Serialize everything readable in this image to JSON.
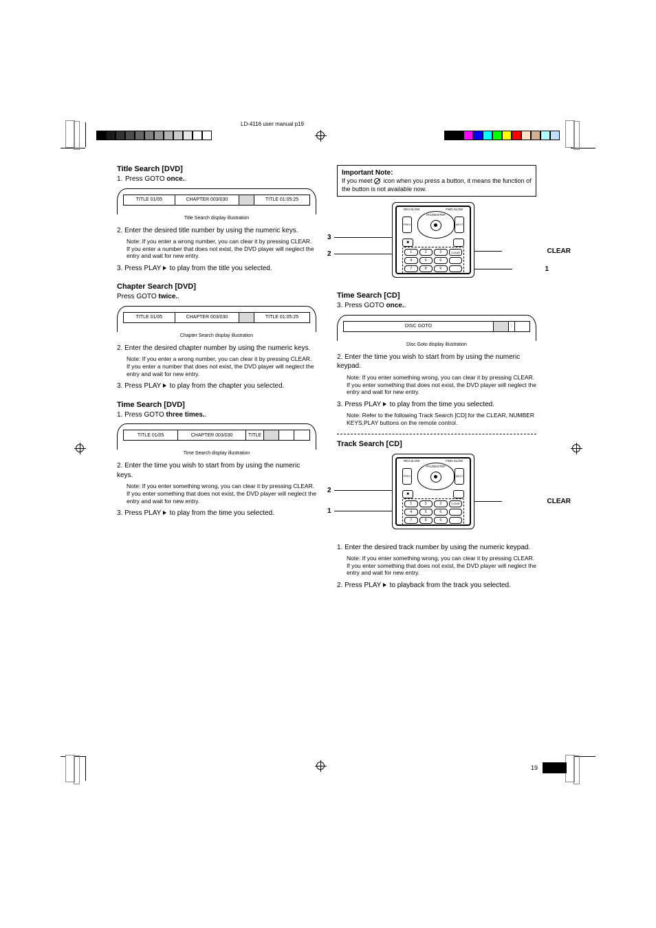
{
  "meta": {
    "filename": "LD-4116 user manual p19",
    "page_number": "19"
  },
  "marks": {
    "gray_swatches": [
      "#000000",
      "#1a1a1a",
      "#333333",
      "#4d4d4d",
      "#666666",
      "#808080",
      "#999999",
      "#b3b3b3",
      "#cccccc",
      "#e6e6e6",
      "#ffffff",
      "#ffffff"
    ],
    "color_swatches": [
      "#ff00ff",
      "#0000ff",
      "#00ffff",
      "#00ff00",
      "#ffff00",
      "#ff0000",
      "#ffe0c0",
      "#d0b090",
      "#b0ffff",
      "#c0e0ff",
      "#000000",
      "#000000"
    ]
  },
  "important_note": {
    "title": "Important Note:",
    "body_1": "If you meet ",
    "body_2": " icon when you press a button, it means the function of the button is not available now."
  },
  "remote_labels": {
    "clear": "CLEAR",
    "num1": "1",
    "num2": "2",
    "num3": "3",
    "pause": "PAUSE/STEP",
    "prev": "PREV",
    "next": "NEXT",
    "rev": "REV.SLOW",
    "fwd": "FWD.SLOW",
    "stop": "■",
    "btn_clear": "CLEAR"
  },
  "left": {
    "title_search": {
      "heading": "Title Search [DVD]",
      "step1a": "1. Press GOTO ",
      "step1b": "once.",
      "display_caption": "Title Search display illustration",
      "seg1": "TITLE   01/05",
      "seg2": "CHAPTER   003/030",
      "seg3": "",
      "seg4": "TITLE   01:05:25",
      "step2": "2. Enter the desired title number by using the numeric keys.",
      "note1": "Note: If you enter a wrong number, you can clear it by pressing CLEAR. If you enter a number that does not exist, the DVD player will neglect the entry and wait for new entry.",
      "step3_pre": "3. Press PLAY ",
      "step3_post": " to play from the title you selected."
    },
    "chapter_search": {
      "heading": "Chapter Search [DVD]",
      "step1a": "1. Press GOTO ",
      "step1b": "twice.",
      "display_caption": "Chapter Search display illustration",
      "seg1": "TITLE   01/05",
      "seg2": "CHAPTER   003/030",
      "seg3": "",
      "seg4": "TITLE   01:05:25",
      "step2": "2. Enter the desired chapter number by using the numeric keys.",
      "note1": "Note: If you enter a wrong number, you can clear it by pressing CLEAR. If you enter a number that does not exist, the DVD player will neglect the entry and wait for new entry.",
      "step3_pre": "3. Press PLAY ",
      "step3_post": " to play from the chapter you selected."
    },
    "time_search": {
      "heading": "Time Search [DVD]",
      "step1a": "1. Press GOTO ",
      "step1b": "three times.",
      "display_caption": "Time Search display illustration",
      "seg1": "TITLE   01/05",
      "seg2": "CHAPTER   003/030",
      "seg3": "TITLE",
      "seg4": "",
      "seg5": "",
      "seg6": "",
      "step2": "2. Enter the time you wish to start from by using the numeric keys.",
      "note1": "Note: If you enter something wrong, you can clear it by pressing CLEAR. If you enter something that does not exist, the DVD player will neglect the entry and wait for new entry.",
      "step3_pre": "3. Press PLAY ",
      "step3_post": " to play from the time you selected."
    }
  },
  "right": {
    "time_search_cd": {
      "heading": "Time Search [CD]",
      "step1a": "3. Press GOTO ",
      "step1b": "once.",
      "display_caption": "Disc Goto display illustration",
      "seg1": "DISC GOTO",
      "seg2": "",
      "seg3": ":",
      "seg4": "",
      "step2": "2. Enter the time you wish to start from by using the numeric keypad.",
      "note1": "Note: If you enter something wrong, you can clear it by pressing CLEAR. If you enter something that does not exist, the DVD player will neglect the entry and wait for new entry.",
      "step3_pre": "3. Press PLAY ",
      "step3_post": " to play from the time you selected.",
      "note2": "Note: Refer to the following Track Search [CD] for the CLEAR, NUMBER KEYS,PLAY buttons on the remote control."
    },
    "track_search_cd": {
      "heading": "Track Search [CD]",
      "step1": "1. Enter the desired track number by using the numeric keypad.",
      "note1": "Note: If you enter something wrong, you can clear it by pressing CLEAR. If you enter something that does not exist, the DVD player will neglect the entry and wait for new entry.",
      "step2_pre": "2. Press PLAY ",
      "step2_post": " to playback from the track you selected."
    }
  }
}
